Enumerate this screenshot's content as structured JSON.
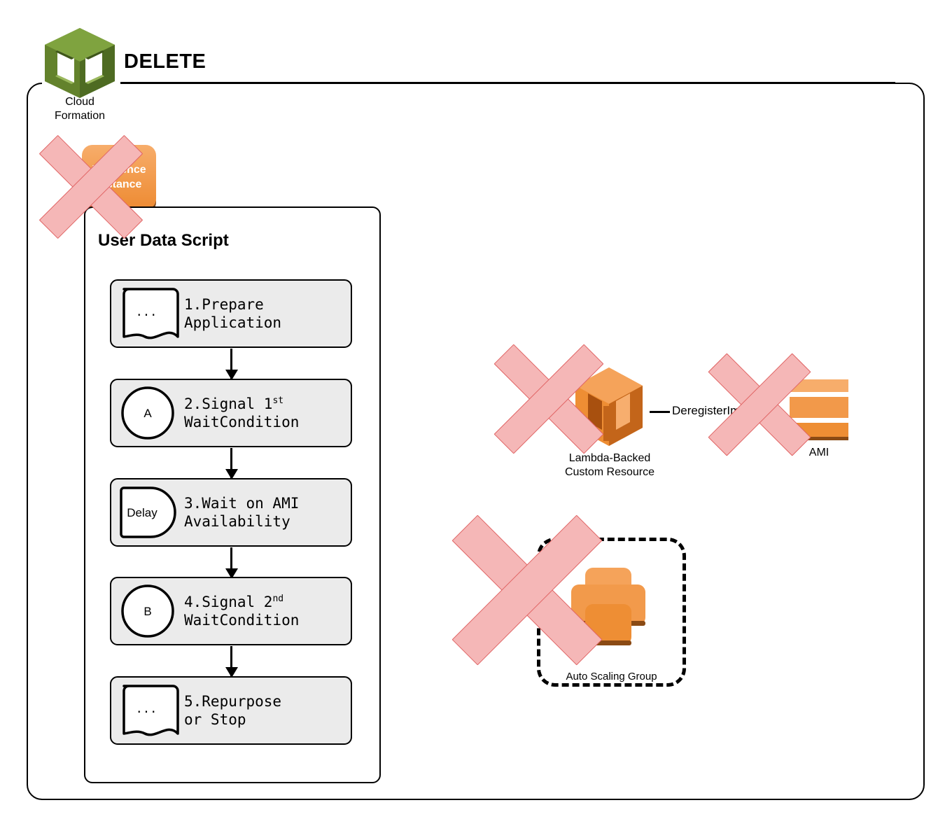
{
  "title": "DELETE",
  "cloudformation": {
    "icon": "cloudformation-cube-icon",
    "label": "Cloud\nFormation",
    "label_line1": "Cloud",
    "label_line2": "Formation",
    "color": "#5c7a28"
  },
  "reference_instance": {
    "label_line1": "Reference",
    "label_line2": "Instance",
    "color": "#f29a4b",
    "deleted": true
  },
  "user_data_script": {
    "title": "User Data Script",
    "steps": [
      {
        "number": "1.",
        "icon": "document-note-icon",
        "icon_label": "...",
        "text": "1.Prepare\nApplication"
      },
      {
        "number": "2.",
        "icon": "connector-circle-icon",
        "icon_label": "A",
        "text_pre": "2.Signal 1",
        "text_sup": "st",
        "text_post": "\nWaitCondition"
      },
      {
        "number": "3.",
        "icon": "delay-icon",
        "icon_label": "Delay",
        "text": "3.Wait on AMI\nAvailability"
      },
      {
        "number": "4.",
        "icon": "connector-circle-icon",
        "icon_label": "B",
        "text_pre": "4.Signal 2",
        "text_sup": "nd",
        "text_post": "\nWaitCondition"
      },
      {
        "number": "5.",
        "icon": "document-note-icon",
        "icon_label": "...",
        "text": "5.Repurpose\nor Stop"
      }
    ]
  },
  "lambda_custom_resource": {
    "label_line1": "Lambda-Backed",
    "label_line2": "Custom Resource",
    "icon": "lambda-cube-icon",
    "color": "#ed8b33",
    "deleted": true
  },
  "ami": {
    "label": "AMI",
    "icon": "ami-icon",
    "color": "#f2994a",
    "deleted": true
  },
  "connector": {
    "label": "DeregisterImage"
  },
  "auto_scaling_group": {
    "label": "Auto Scaling Group",
    "deleted": true
  },
  "delete_marker": {
    "fill": "#f5b7b7",
    "stroke": "#e06464"
  }
}
